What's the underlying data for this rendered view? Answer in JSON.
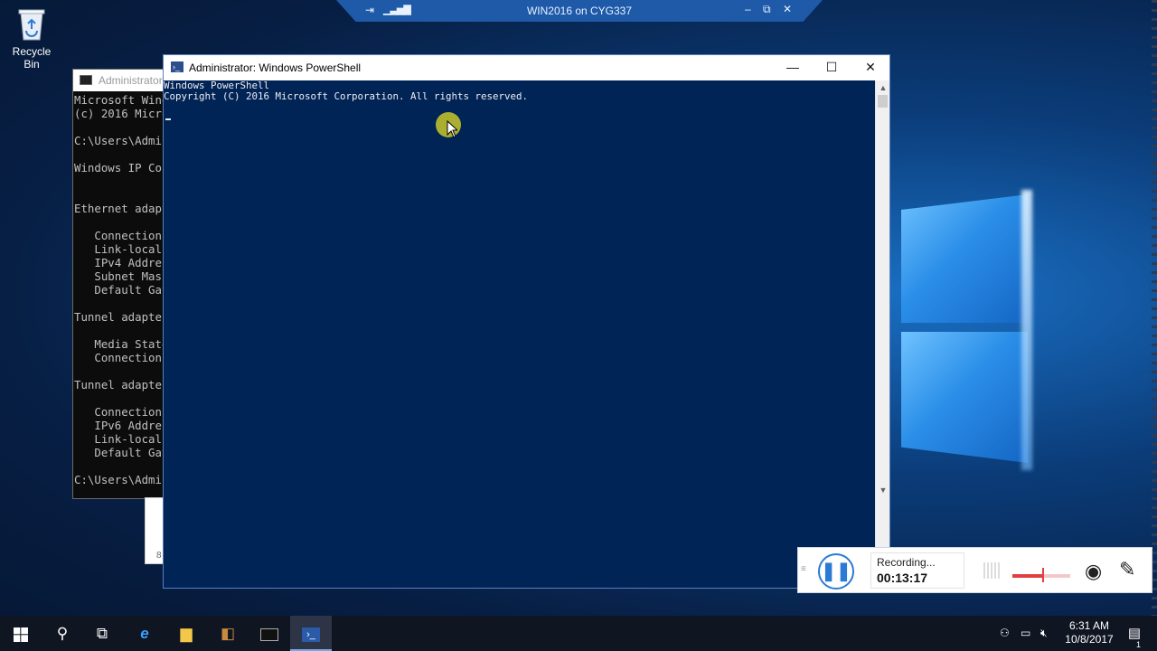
{
  "desktop": {
    "recycle_bin_label": "Recycle Bin"
  },
  "remote_bar": {
    "title": "WIN2016 on CYG337",
    "minimize": "–",
    "restore": "⧉",
    "close": "✕"
  },
  "cmd_window": {
    "title": "Administrator",
    "console_text": "Microsoft Wind\n(c) 2016 Micro\n\nC:\\Users\\Admi\n\nWindows IP Con\n\n\nEthernet adapt\n\n   Connection\n   Link-local\n   IPv4 Addres\n   Subnet Mask\n   Default Gat\n\nTunnel adapter\n\n   Media State\n   Connection\n\nTunnel adapter\n\n   Connection\n   IPv6 Addres\n   Link-local\n   Default Gat\n\nC:\\Users\\Admi"
  },
  "ghost_window": {
    "text": "8"
  },
  "powershell_window": {
    "title": "Administrator: Windows PowerShell",
    "console_text": "Windows PowerShell\nCopyright (C) 2016 Microsoft Corporation. All rights reserved.",
    "minimize": "—",
    "maximize": "☐",
    "close": "✕"
  },
  "recorder": {
    "status_label": "Recording...",
    "elapsed": "00:13:17"
  },
  "taskbar": {
    "items": [
      "start",
      "search",
      "task-view",
      "internet-explorer",
      "file-explorer",
      "server-manager",
      "command-prompt",
      "powershell"
    ],
    "active": "powershell"
  },
  "clock": {
    "time": "6:31 AM",
    "date": "10/8/2017"
  },
  "notification_count": "1",
  "colors": {
    "powershell_bg": "#012456",
    "cmd_bg": "#0c0c0c",
    "taskbar_bg": "#101522",
    "accent": "#2b7bd4"
  }
}
